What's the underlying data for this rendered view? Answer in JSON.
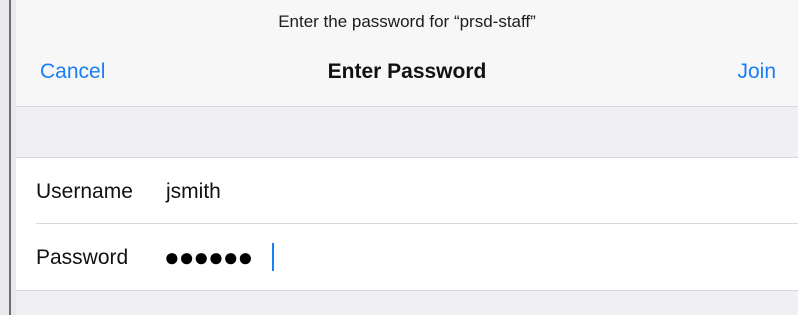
{
  "dialog": {
    "prompt": "Enter the password for “prsd-staff”",
    "title": "Enter Password",
    "cancel_label": "Cancel",
    "join_label": "Join"
  },
  "form": {
    "username_label": "Username",
    "username_value": "jsmith",
    "password_label": "Password",
    "password_masked": "●●●●●●"
  },
  "colors": {
    "accent": "#1a7ef7",
    "nav_bg": "#f7f7f7",
    "group_bg": "#f0eff4"
  }
}
